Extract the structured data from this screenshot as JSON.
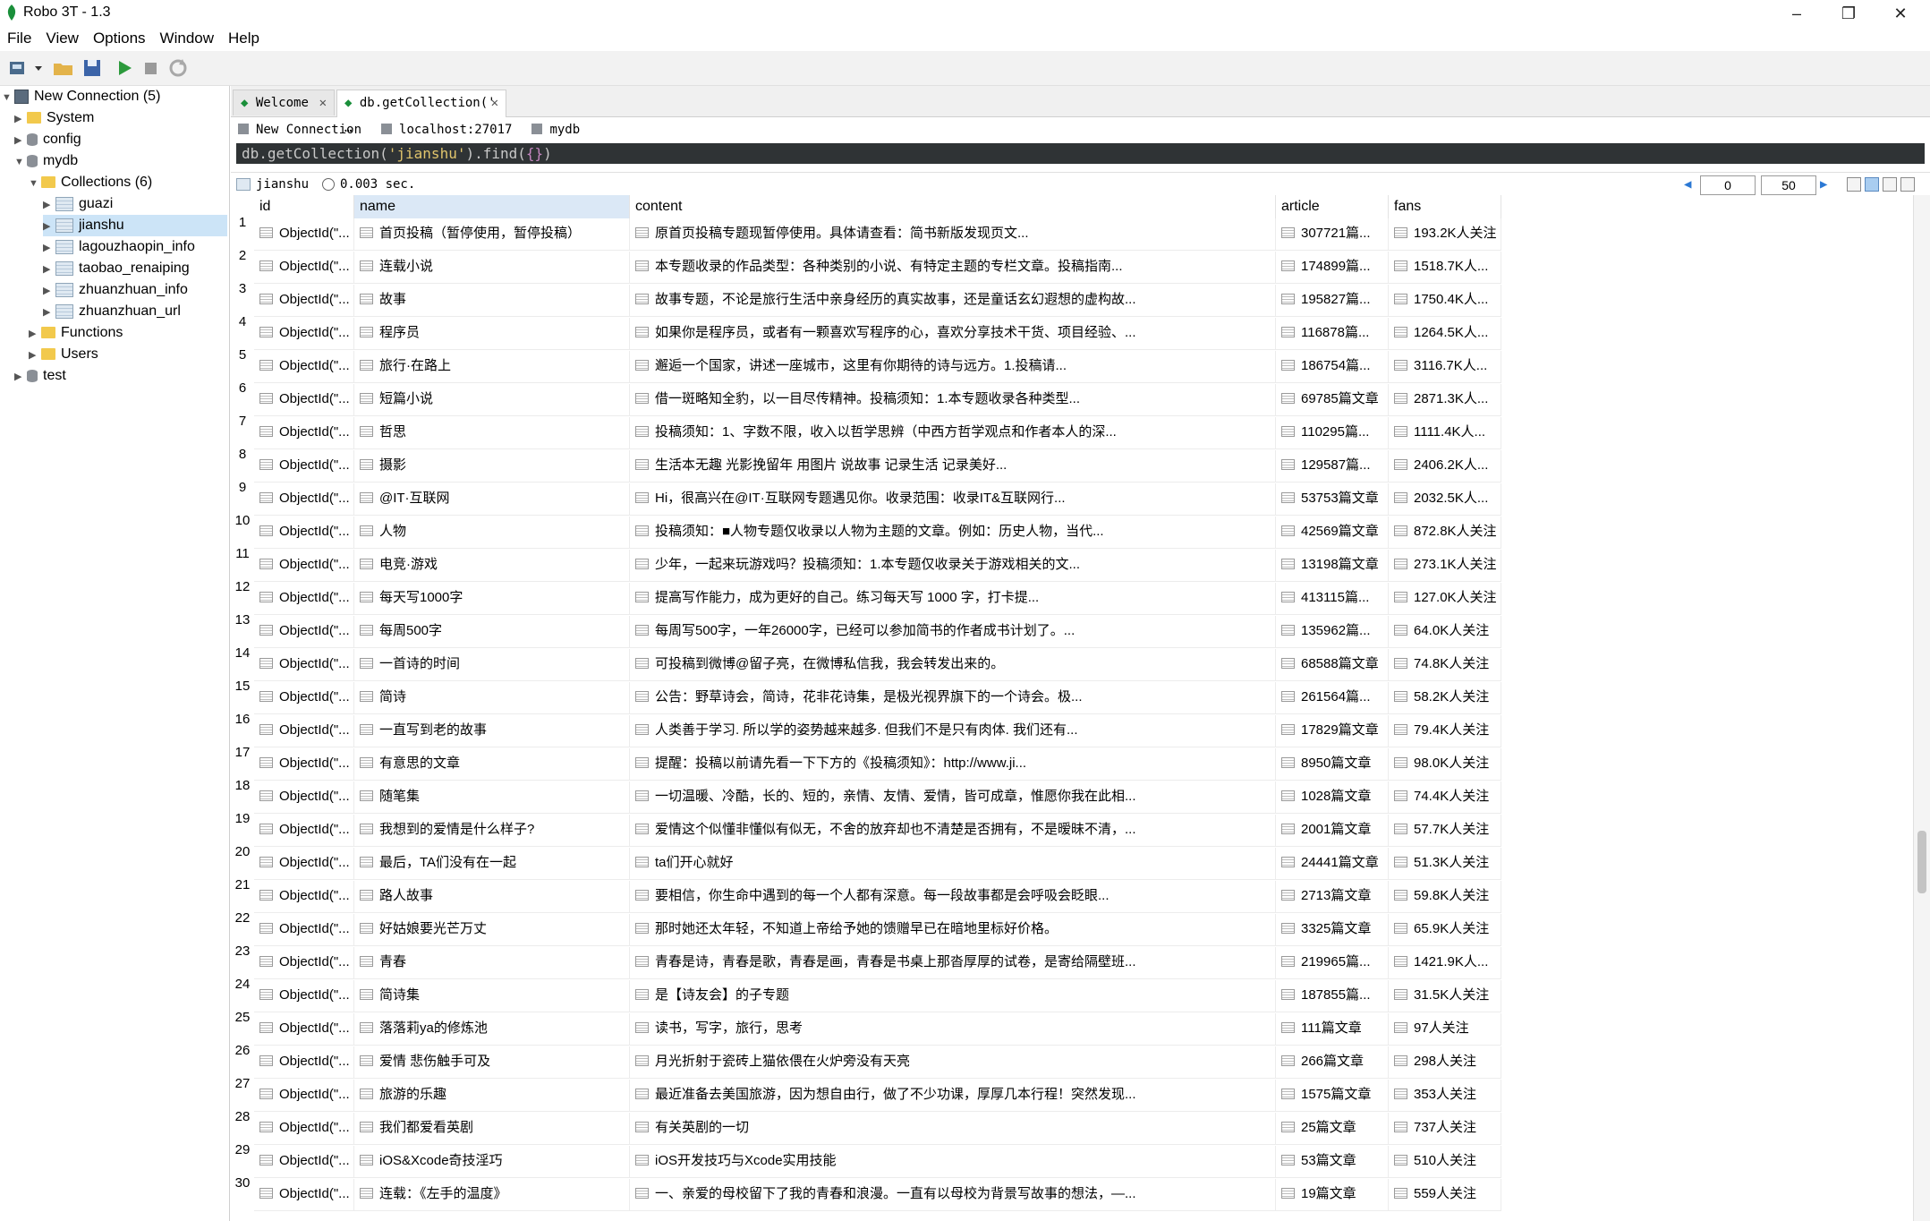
{
  "window": {
    "title": "Robo 3T - 1.3",
    "min_glyph": "–",
    "max_glyph": "❐",
    "close_glyph": "✕"
  },
  "menu": [
    "File",
    "View",
    "Options",
    "Window",
    "Help"
  ],
  "sidebar": {
    "connection": "New Connection (5)",
    "system": "System",
    "config": "config",
    "mydb": "mydb",
    "collections": "Collections (6)",
    "coll_items": [
      "guazi",
      "jianshu",
      "lagouzhaopin_info",
      "taobao_renaiping",
      "zhuanzhuan_info",
      "zhuanzhuan_url"
    ],
    "functions": "Functions",
    "users": "Users",
    "test": "test"
  },
  "tabs": {
    "welcome": "Welcome",
    "query": "db.getCollection(' …",
    "close_glyph": "✕"
  },
  "breadcrumb": {
    "connection": "New Connection",
    "host": "localhost:27017",
    "db": "mydb"
  },
  "query": {
    "fn": "db.getCollection(",
    "str": "'jianshu'",
    "rest": ").find(",
    "braces": "{}",
    "end": ")"
  },
  "results": {
    "collection": "jianshu",
    "time": "0.003 sec.",
    "page_from": "0",
    "page_size": "50"
  },
  "columns": {
    "id": "id",
    "name": "name",
    "content": "content",
    "article": "article",
    "fans": "fans"
  },
  "rows": [
    {
      "n": "1",
      "id": "ObjectId(\"...",
      "name": "首页投稿（暂停使用，暂停投稿）",
      "content": "原首页投稿专题现暂停使用。具体请查看：简书新版发现页文...",
      "article": "307721篇...",
      "fans": "193.2K人关注"
    },
    {
      "n": "2",
      "id": "ObjectId(\"...",
      "name": "连载小说",
      "content": "本专题收录的作品类型：各种类别的小说、有特定主题的专栏文章。投稿指南...",
      "article": "174899篇...",
      "fans": "1518.7K人..."
    },
    {
      "n": "3",
      "id": "ObjectId(\"...",
      "name": "故事",
      "content": "故事专题，不论是旅行生活中亲身经历的真实故事，还是童话玄幻遐想的虚构故...",
      "article": "195827篇...",
      "fans": "1750.4K人..."
    },
    {
      "n": "4",
      "id": "ObjectId(\"...",
      "name": "程序员",
      "content": "如果你是程序员，或者有一颗喜欢写程序的心，喜欢分享技术干货、项目经验、...",
      "article": "116878篇...",
      "fans": "1264.5K人..."
    },
    {
      "n": "5",
      "id": "ObjectId(\"...",
      "name": "旅行·在路上",
      "content": "邂逅一个国家，讲述一座城市，这里有你期待的诗与远方。1.投稿请...",
      "article": "186754篇...",
      "fans": "3116.7K人..."
    },
    {
      "n": "6",
      "id": "ObjectId(\"...",
      "name": "短篇小说",
      "content": "借一斑略知全豹，以一目尽传精神。投稿须知：1.本专题收录各种类型...",
      "article": "69785篇文章",
      "fans": "2871.3K人..."
    },
    {
      "n": "7",
      "id": "ObjectId(\"...",
      "name": "哲思",
      "content": "投稿须知：1、字数不限，收入以哲学思辨（中西方哲学观点和作者本人的深...",
      "article": "110295篇...",
      "fans": "1111.4K人..."
    },
    {
      "n": "8",
      "id": "ObjectId(\"...",
      "name": "摄影",
      "content": "生活本无趣 光影挽留年 用图片 说故事 记录生活 记录美好...",
      "article": "129587篇...",
      "fans": "2406.2K人..."
    },
    {
      "n": "9",
      "id": "ObjectId(\"...",
      "name": "@IT·互联网",
      "content": "Hi，很高兴在@IT·互联网专题遇见你。收录范围：收录IT&互联网行...",
      "article": "53753篇文章",
      "fans": "2032.5K人..."
    },
    {
      "n": "10",
      "id": "ObjectId(\"...",
      "name": "人物",
      "content": "投稿须知：■人物专题仅收录以人物为主题的文章。例如：历史人物，当代...",
      "article": "42569篇文章",
      "fans": "872.8K人关注"
    },
    {
      "n": "11",
      "id": "ObjectId(\"...",
      "name": "电竞·游戏",
      "content": "少年，一起来玩游戏吗？投稿须知：1.本专题仅收录关于游戏相关的文...",
      "article": "13198篇文章",
      "fans": "273.1K人关注"
    },
    {
      "n": "12",
      "id": "ObjectId(\"...",
      "name": "每天写1000字",
      "content": "提高写作能力，成为更好的自己。练习每天写 1000 字，打卡提...",
      "article": "413115篇...",
      "fans": "127.0K人关注"
    },
    {
      "n": "13",
      "id": "ObjectId(\"...",
      "name": "每周500字",
      "content": "每周写500字，一年26000字，已经可以参加简书的作者成书计划了。...",
      "article": "135962篇...",
      "fans": "64.0K人关注"
    },
    {
      "n": "14",
      "id": "ObjectId(\"...",
      "name": "一首诗的时间",
      "content": "可投稿到微博@留子亮，在微博私信我，我会转发出来的。",
      "article": "68588篇文章",
      "fans": "74.8K人关注"
    },
    {
      "n": "15",
      "id": "ObjectId(\"...",
      "name": "简诗",
      "content": "公告：野草诗会，简诗，花非花诗集，是极光视界旗下的一个诗会。极...",
      "article": "261564篇...",
      "fans": "58.2K人关注"
    },
    {
      "n": "16",
      "id": "ObjectId(\"...",
      "name": "一直写到老的故事",
      "content": "人类善于学习. 所以学的姿势越来越多. 但我们不是只有肉体. 我们还有...",
      "article": "17829篇文章",
      "fans": "79.4K人关注"
    },
    {
      "n": "17",
      "id": "ObjectId(\"...",
      "name": "有意思的文章",
      "content": "提醒：投稿以前请先看一下下方的《投稿须知》：http://www.ji...",
      "article": "8950篇文章",
      "fans": "98.0K人关注"
    },
    {
      "n": "18",
      "id": "ObjectId(\"...",
      "name": "随笔集",
      "content": "一切温暖、冷酷，长的、短的，亲情、友情、爱情，皆可成章，惟愿你我在此相...",
      "article": "1028篇文章",
      "fans": "74.4K人关注"
    },
    {
      "n": "19",
      "id": "ObjectId(\"...",
      "name": "我想到的爱情是什么样子?",
      "content": "爱情这个似懂非懂似有似无，不舍的放弃却也不清楚是否拥有，不是暧昧不清，...",
      "article": "2001篇文章",
      "fans": "57.7K人关注"
    },
    {
      "n": "20",
      "id": "ObjectId(\"...",
      "name": "最后，TA们没有在一起",
      "content": "ta们开心就好",
      "article": "24441篇文章",
      "fans": "51.3K人关注"
    },
    {
      "n": "21",
      "id": "ObjectId(\"...",
      "name": "路人故事",
      "content": "要相信，你生命中遇到的每一个人都有深意。每一段故事都是会呼吸会眨眼...",
      "article": "2713篇文章",
      "fans": "59.8K人关注"
    },
    {
      "n": "22",
      "id": "ObjectId(\"...",
      "name": "好姑娘要光芒万丈",
      "content": "那时她还太年轻，不知道上帝给予她的馈赠早已在暗地里标好价格。",
      "article": "3325篇文章",
      "fans": "65.9K人关注"
    },
    {
      "n": "23",
      "id": "ObjectId(\"...",
      "name": "青春",
      "content": "青春是诗，青春是歌，青春是画，青春是书桌上那沓厚厚的试卷，是寄给隔壁班...",
      "article": "219965篇...",
      "fans": "1421.9K人..."
    },
    {
      "n": "24",
      "id": "ObjectId(\"...",
      "name": "简诗集",
      "content": "是【诗友会】的子专题",
      "article": "187855篇...",
      "fans": "31.5K人关注"
    },
    {
      "n": "25",
      "id": "ObjectId(\"...",
      "name": "落落莉ya的修炼池",
      "content": "读书，写字，旅行，思考",
      "article": "111篇文章",
      "fans": "97人关注"
    },
    {
      "n": "26",
      "id": "ObjectId(\"...",
      "name": "爱情 悲伤触手可及",
      "content": "月光折射于瓷砖上猫依偎在火炉旁没有天亮",
      "article": "266篇文章",
      "fans": "298人关注"
    },
    {
      "n": "27",
      "id": "ObjectId(\"...",
      "name": "旅游的乐趣",
      "content": "最近准备去美国旅游，因为想自由行，做了不少功课，厚厚几本行程！突然发现...",
      "article": "1575篇文章",
      "fans": "353人关注"
    },
    {
      "n": "28",
      "id": "ObjectId(\"...",
      "name": "我们都爱看英剧",
      "content": "有关英剧的一切",
      "article": "25篇文章",
      "fans": "737人关注"
    },
    {
      "n": "29",
      "id": "ObjectId(\"...",
      "name": "iOS&Xcode奇技淫巧",
      "content": "iOS开发技巧与Xcode实用技能",
      "article": "53篇文章",
      "fans": "510人关注"
    },
    {
      "n": "30",
      "id": "ObjectId(\"...",
      "name": "连载：《左手的温度》",
      "content": "一、亲爱的母校留下了我的青春和浪漫。一直有以母校为背景写故事的想法，—...",
      "article": "19篇文章",
      "fans": "559人关注"
    }
  ],
  "colors": {
    "accent_green": "#1a8f3a",
    "selection": "#cce4f7",
    "query_bg": "#2f3335"
  }
}
